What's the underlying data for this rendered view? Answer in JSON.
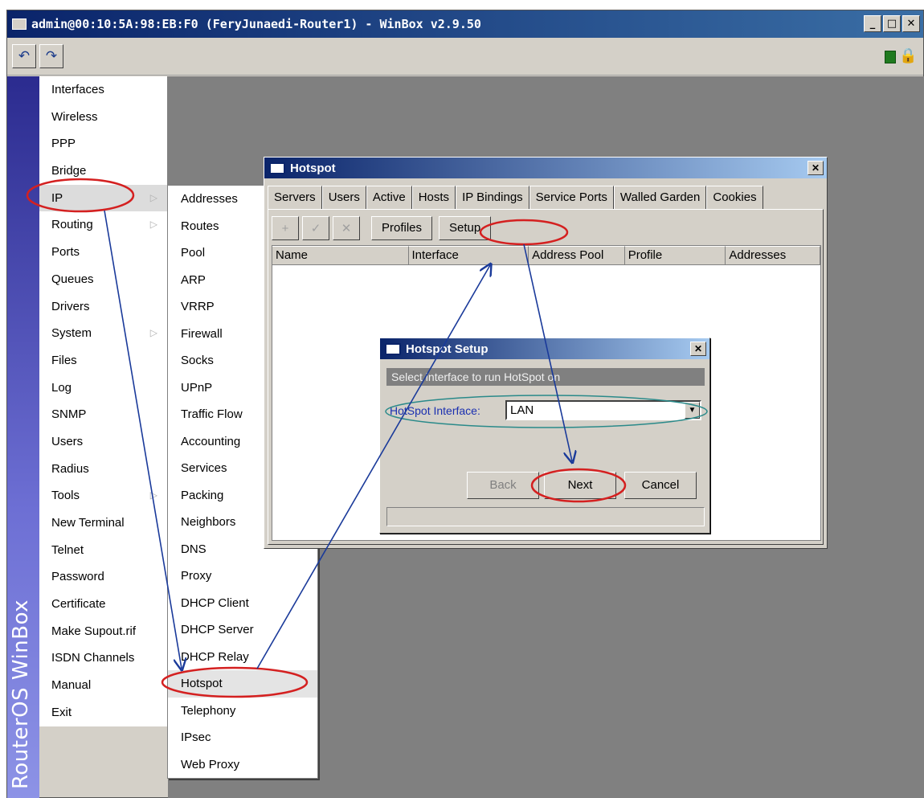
{
  "titlebar": {
    "title": "admin@00:10:5A:98:EB:F0 (FeryJunaedi-Router1) - WinBox v2.9.50",
    "minimize": "_",
    "maximize": "□",
    "close": "✕"
  },
  "toolbar": {
    "undo_icon": "undo-icon",
    "redo_icon": "redo-icon"
  },
  "sidebar": {
    "brand": "RouterOS WinBox",
    "items": [
      {
        "label": "Interfaces"
      },
      {
        "label": "Wireless"
      },
      {
        "label": "PPP"
      },
      {
        "label": "Bridge"
      },
      {
        "label": "IP",
        "submenu": true
      },
      {
        "label": "Routing",
        "submenu": true
      },
      {
        "label": "Ports"
      },
      {
        "label": "Queues"
      },
      {
        "label": "Drivers"
      },
      {
        "label": "System",
        "submenu": true
      },
      {
        "label": "Files"
      },
      {
        "label": "Log"
      },
      {
        "label": "SNMP"
      },
      {
        "label": "Users"
      },
      {
        "label": "Radius"
      },
      {
        "label": "Tools",
        "submenu": true
      },
      {
        "label": "New Terminal"
      },
      {
        "label": "Telnet"
      },
      {
        "label": "Password"
      },
      {
        "label": "Certificate"
      },
      {
        "label": "Make Supout.rif"
      },
      {
        "label": "ISDN Channels"
      },
      {
        "label": "Manual"
      },
      {
        "label": "Exit"
      }
    ]
  },
  "ip_submenu": {
    "items": [
      "Addresses",
      "Routes",
      "Pool",
      "ARP",
      "VRRP",
      "Firewall",
      "Socks",
      "UPnP",
      "Traffic Flow",
      "Accounting",
      "Services",
      "Packing",
      "Neighbors",
      "DNS",
      "Proxy",
      "DHCP Client",
      "DHCP Server",
      "DHCP Relay",
      "Hotspot",
      "Telephony",
      "IPsec",
      "Web Proxy"
    ]
  },
  "hotspot_window": {
    "title": "Hotspot",
    "close": "✕",
    "tabs": [
      "Servers",
      "Users",
      "Active",
      "Hosts",
      "IP Bindings",
      "Service Ports",
      "Walled Garden",
      "Cookies"
    ],
    "buttons": {
      "add": "+",
      "enable": "✓",
      "disable": "✕",
      "profiles": "Profiles",
      "setup": "Setup"
    },
    "columns": [
      "Name",
      "Interface",
      "Address Pool",
      "Profile",
      "Addresses"
    ]
  },
  "setup_dialog": {
    "title": "Hotspot Setup",
    "close": "✕",
    "prompt": "Select interface to run HotSpot on",
    "interface_label": "HotSpot Interface:",
    "interface_value": "LAN",
    "buttons": {
      "back": "Back",
      "next": "Next",
      "cancel": "Cancel"
    }
  },
  "colors": {
    "title_gradient_start": "#0a246a",
    "annotation_red": "#d42020",
    "annotation_blue": "#1a3a9a"
  }
}
